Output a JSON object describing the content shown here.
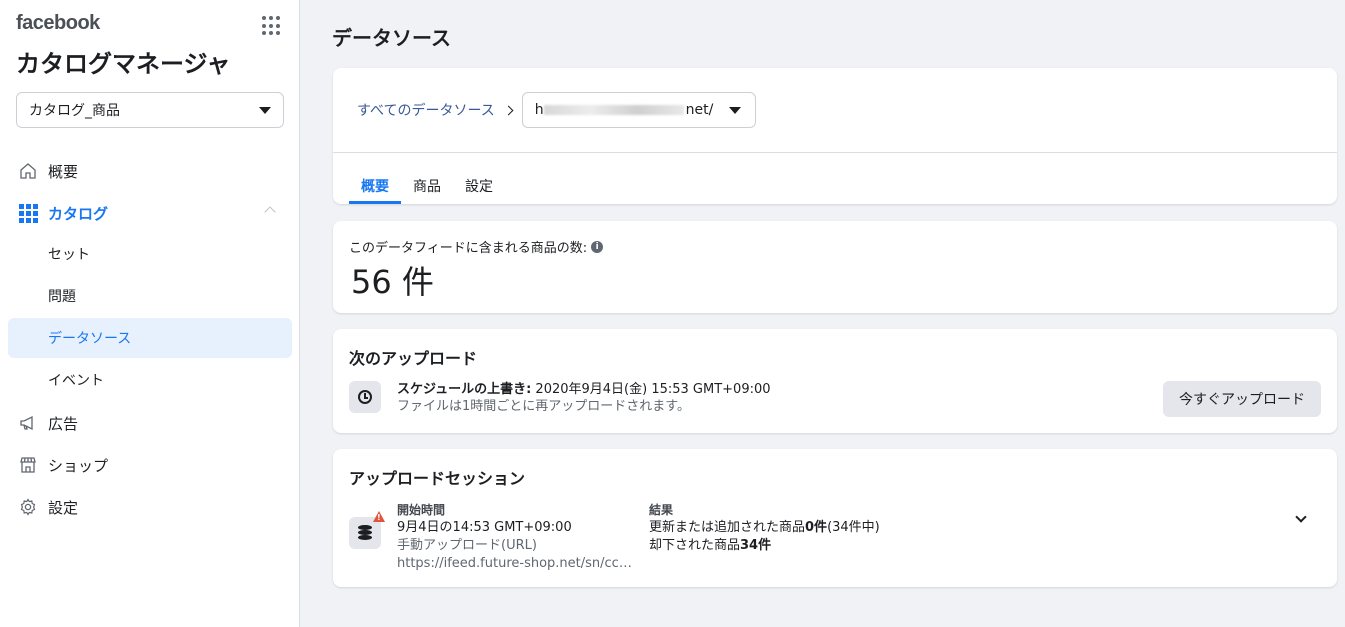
{
  "brand": "facebook",
  "app_title": "カタログマネージャ",
  "catalog_select": {
    "value": "カタログ_商品"
  },
  "nav": {
    "overview": "概要",
    "catalog": "カタログ",
    "sets": "セット",
    "issues": "問題",
    "data_sources": "データソース",
    "events": "イベント",
    "ads": "広告",
    "shop": "ショップ",
    "settings": "設定"
  },
  "page_title": "データソース",
  "breadcrumb": {
    "all_sources": "すべてのデータソース",
    "source_prefix": "h",
    "source_suffix": "net/"
  },
  "tabs": [
    "概要",
    "商品",
    "設定"
  ],
  "feed_count": {
    "label": "このデータフィードに含まれる商品の数:",
    "info_glyph": "i",
    "value": "56 件"
  },
  "next_upload": {
    "heading": "次のアップロード",
    "schedule_label": "スケジュールの上書き:",
    "schedule_value": " 2020年9月4日(金) 15:53 GMT+09:00",
    "frequency": "ファイルは1時間ごとに再アップロードされます。",
    "upload_now_button": "今すぐアップロード"
  },
  "upload_session": {
    "heading": "アップロードセッション",
    "start_header": "開始時間",
    "start_time": "9月4日の14:53 GMT+09:00",
    "method": "手動アップロード(URL)",
    "url": "https://ifeed.future-shop.net/sn/ccdo…",
    "result_header": "結果",
    "updated_prefix": "更新または追加された商品",
    "updated_count": "0件",
    "updated_suffix": "(34件中)",
    "rejected_prefix": "却下された商品",
    "rejected_count": "34件"
  },
  "colors": {
    "accent": "#1877f2",
    "warning": "#e0533d",
    "link": "#385898"
  }
}
